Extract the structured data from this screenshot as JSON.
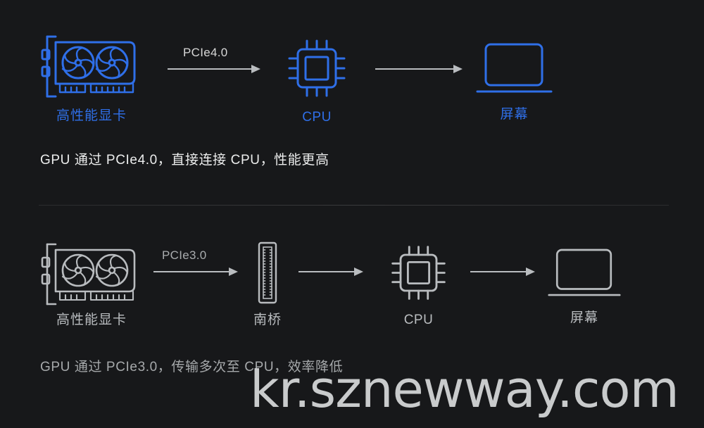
{
  "background_color": "#17181a",
  "accent_blue": "#2f6fe8",
  "accent_gray": "#b9bcbf",
  "rows": [
    {
      "id": "pcie4-row",
      "theme": "blue",
      "nodes": [
        {
          "id": "gpu",
          "icon": "graphics-card-icon",
          "label": "高性能显卡"
        },
        {
          "id": "cpu",
          "icon": "cpu-chip-icon",
          "label": "CPU"
        },
        {
          "id": "screen",
          "icon": "monitor-icon",
          "label": "屏幕"
        }
      ],
      "arrows": [
        {
          "id": "gpu-to-cpu",
          "caption": "PCIe4.0"
        },
        {
          "id": "cpu-to-screen",
          "caption": ""
        }
      ],
      "caption": "GPU 通过 PCIe4.0，直接连接 CPU，性能更高"
    },
    {
      "id": "pcie3-row",
      "theme": "gray",
      "nodes": [
        {
          "id": "gpu",
          "icon": "graphics-card-icon",
          "label": "高性能显卡"
        },
        {
          "id": "southbridge",
          "icon": "slot-connector-icon",
          "label": "南桥"
        },
        {
          "id": "cpu",
          "icon": "cpu-chip-icon",
          "label": "CPU"
        },
        {
          "id": "screen",
          "icon": "monitor-icon",
          "label": "屏幕"
        }
      ],
      "arrows": [
        {
          "id": "gpu-to-southbridge",
          "caption": "PCIe3.0"
        },
        {
          "id": "southbridge-to-cpu",
          "caption": ""
        },
        {
          "id": "cpu-to-screen",
          "caption": ""
        }
      ],
      "caption": "GPU 通过 PCIe3.0，传输多次至 CPU，效率降低"
    }
  ],
  "watermark": "kr.sznewway.com"
}
